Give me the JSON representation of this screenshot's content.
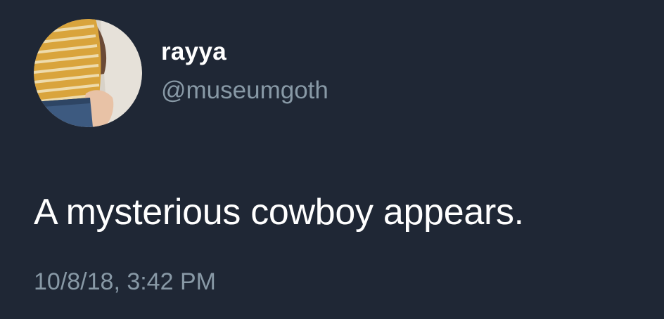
{
  "tweet": {
    "display_name": "rayya",
    "handle": "@museumgoth",
    "text": "A mysterious cowboy appears.",
    "timestamp": "10/8/18, 3:42 PM"
  },
  "colors": {
    "background": "#1f2735",
    "primary_text": "#ffffff",
    "secondary_text": "#8899a6",
    "avatar_shirt": "#d9a43c"
  },
  "icons": {
    "avatar": "profile-photo-avatar"
  }
}
